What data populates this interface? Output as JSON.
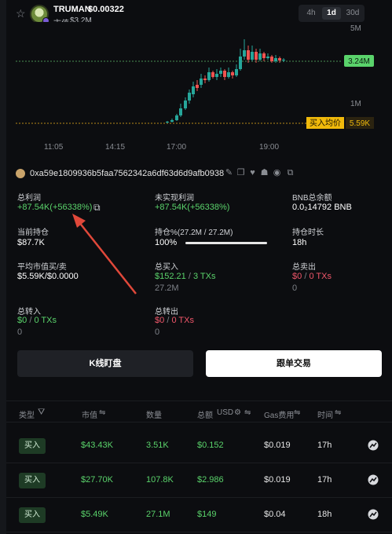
{
  "header": {
    "token_name": "TRUMAN",
    "token_price": "$0.00322",
    "mcap_label": "市值",
    "mcap_value": "$3.2M",
    "timeframes": [
      "4h",
      "1d",
      "30d"
    ],
    "active_timeframe": "1d"
  },
  "chart": {
    "y_labels": [
      "5M",
      "1M"
    ],
    "price_tag": "3.24M",
    "avg_buy_label": "买入均价",
    "avg_buy_value": "5.59K",
    "x_labels": [
      "11:05",
      "14:15",
      "17:00",
      "19:00"
    ],
    "colors": {
      "up": "#26a69a",
      "down": "#ef5350",
      "price_line": "#5ad36b",
      "avg_line": "#f0b90b"
    }
  },
  "address": {
    "text": "0xa59e1809936b5faa7562342a6df63d6d9afb0938"
  },
  "stats": {
    "total_profit_label": "总利润",
    "total_profit_value": "+87.54K(+56338%)",
    "unrealized_label": "未实现利润",
    "unrealized_value": "+87.54K(+56338%)",
    "bnb_label": "BNB总余额",
    "bnb_value": "0.0₂14792 BNB",
    "holding_label": "当前持仓",
    "holding_value": "$87.7K",
    "holding_pct_label": "持仓%(27.2M / 27.2M)",
    "holding_pct_value": "100%",
    "holding_pct_fraction": 1.0,
    "hold_time_label": "持仓时长",
    "hold_time_value": "18h",
    "avg_mcap_label": "平均市值买/卖",
    "avg_mcap_value": "$5.59K/$0.0000",
    "total_buy_label": "总买入",
    "total_buy_amount": "$152.21",
    "total_buy_sep": "/",
    "total_buy_txs": "3 TXs",
    "total_buy_qty": "27.2M",
    "total_sell_label": "总卖出",
    "total_sell_amount": "$0",
    "total_sell_sep": "/",
    "total_sell_txs": "0 TXs",
    "total_sell_qty": "0",
    "transfer_in_label": "总转入",
    "transfer_in_amount": "$0",
    "transfer_in_sep": "/",
    "transfer_in_txs": "0 TXs",
    "transfer_in_qty": "0",
    "transfer_out_label": "总转出",
    "transfer_out_amount": "$0",
    "transfer_out_sep": "/",
    "transfer_out_txs": "0 TXs",
    "transfer_out_qty": "0"
  },
  "buttons": {
    "kline_label": "K线盯盘",
    "copy_trade_label": "跟单交易"
  },
  "table": {
    "headers": [
      "类型",
      "市值",
      "数量",
      "总额",
      "USD",
      "Gas费用",
      "时间"
    ],
    "rows": [
      {
        "type": "买入",
        "mcap": "$43.43K",
        "qty": "3.51K",
        "total": "$0.152",
        "gas": "$0.019",
        "time": "17h"
      },
      {
        "type": "买入",
        "mcap": "$27.70K",
        "qty": "107.8K",
        "total": "$2.986",
        "gas": "$0.019",
        "time": "17h"
      },
      {
        "type": "买入",
        "mcap": "$5.49K",
        "qty": "27.1M",
        "total": "$149",
        "gas": "$0.04",
        "time": "18h"
      }
    ]
  }
}
